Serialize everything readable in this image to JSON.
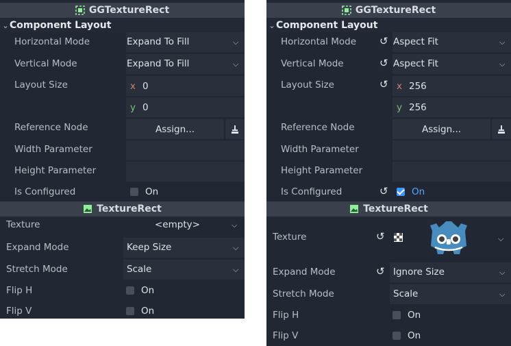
{
  "left": {
    "gg_title": "GGTextureRect",
    "section": "Component Layout",
    "horizontal_mode": {
      "label": "Horizontal Mode",
      "value": "Expand To Fill"
    },
    "vertical_mode": {
      "label": "Vertical Mode",
      "value": "Expand To Fill"
    },
    "layout_size": {
      "label": "Layout Size",
      "x_axis": "x",
      "x": "0",
      "y_axis": "y",
      "y": "0"
    },
    "reference_node": {
      "label": "Reference Node",
      "button": "Assign..."
    },
    "width_param": {
      "label": "Width Parameter",
      "value": ""
    },
    "height_param": {
      "label": "Height Parameter",
      "value": ""
    },
    "is_configured": {
      "label": "Is Configured",
      "value": "On",
      "checked": false
    },
    "tr_title": "TextureRect",
    "texture": {
      "label": "Texture",
      "value": "<empty>"
    },
    "expand_mode": {
      "label": "Expand Mode",
      "value": "Keep Size"
    },
    "stretch_mode": {
      "label": "Stretch Mode",
      "value": "Scale"
    },
    "flip_h": {
      "label": "Flip H",
      "value": "On"
    },
    "flip_v": {
      "label": "Flip V",
      "value": "On"
    }
  },
  "right": {
    "gg_title": "GGTextureRect",
    "section": "Component Layout",
    "horizontal_mode": {
      "label": "Horizontal Mode",
      "value": "Aspect Fit"
    },
    "vertical_mode": {
      "label": "Vertical Mode",
      "value": "Aspect Fit"
    },
    "layout_size": {
      "label": "Layout Size",
      "x_axis": "x",
      "x": "256",
      "y_axis": "y",
      "y": "256"
    },
    "reference_node": {
      "label": "Reference Node",
      "button": "Assign..."
    },
    "width_param": {
      "label": "Width Parameter",
      "value": ""
    },
    "height_param": {
      "label": "Height Parameter",
      "value": ""
    },
    "is_configured": {
      "label": "Is Configured",
      "value": "On",
      "checked": true
    },
    "tr_title": "TextureRect",
    "texture": {
      "label": "Texture",
      "value": "godot-icon"
    },
    "expand_mode": {
      "label": "Expand Mode",
      "value": "Ignore Size"
    },
    "stretch_mode": {
      "label": "Stretch Mode",
      "value": "Scale"
    },
    "flip_h": {
      "label": "Flip H",
      "value": "On"
    },
    "flip_v": {
      "label": "Flip V",
      "value": "On"
    }
  },
  "icons": {
    "gg": "gg-texturerect-node-icon",
    "tr": "texturerect-node-icon",
    "reset": "revert-icon",
    "dropdown": "chevron-down-icon",
    "collapse": "chevron-down-icon",
    "picker": "node-picker-icon",
    "checker": "transparency-checker-icon"
  },
  "colors": {
    "panel_bg": "#222833",
    "header_bg": "#3b414c",
    "field_bg": "#29303b",
    "accent_blue": "#3f95ff",
    "axis_x": "#d4826e",
    "axis_y": "#79c27a",
    "node_icon_green": "#8eef97",
    "godot_blue": "#478cbf"
  }
}
